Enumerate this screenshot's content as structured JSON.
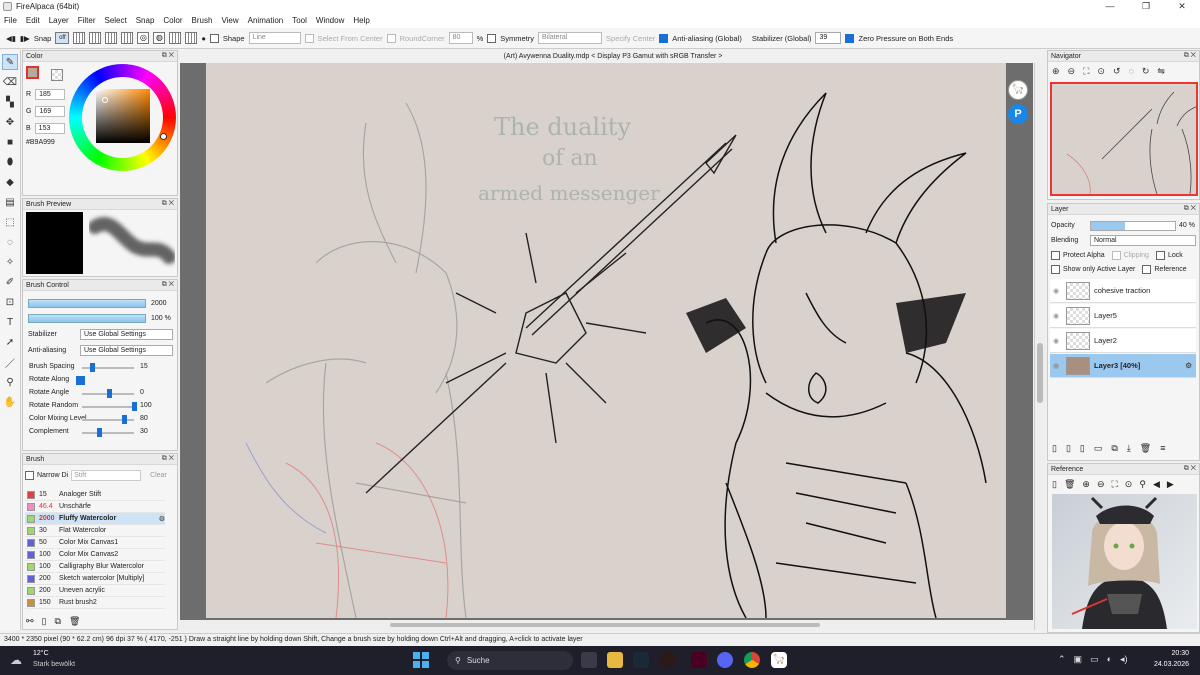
{
  "window": {
    "title": "FireAlpaca (64bit)"
  },
  "menu": [
    "File",
    "Edit",
    "Layer",
    "Filter",
    "Select",
    "Snap",
    "Color",
    "Brush",
    "View",
    "Animation",
    "Tool",
    "Window",
    "Help"
  ],
  "toolbar": {
    "snap_label": "Snap",
    "snap_off": "off",
    "shape_label": "Shape",
    "shape_value": "Line",
    "select_from_center": "Select From Center",
    "round_corner": "RoundCorner",
    "round_corner_value": "80",
    "percent": "%",
    "symmetry_label": "Symmetry",
    "symmetry_value": "Bilateral",
    "specify_center": "Specify Center",
    "anti_aliasing_global": "Anti-aliasing (Global)",
    "stabilizer_global": "Stabilizer (Global)",
    "stabilizer_value": "39",
    "zero_pressure": "Zero Pressure on Both Ends"
  },
  "color_panel": {
    "title": "Color",
    "r_label": "R",
    "r": "185",
    "g_label": "G",
    "g": "169",
    "b_label": "B",
    "b": "153",
    "hex": "#B9A999",
    "current_color": "#B9A999"
  },
  "brush_preview": {
    "title": "Brush Preview"
  },
  "brush_control": {
    "title": "Brush Control",
    "size": "2000",
    "opacity": "100 %",
    "stabilizer_label": "Stabilizer",
    "stabilizer_value": "Use Global Settings",
    "anti_aliasing_label": "Anti-aliasing",
    "anti_aliasing_value": "Use Global Settings",
    "sliders": [
      {
        "label": "Brush Spacing",
        "value": "15",
        "level": 0.15
      },
      {
        "label": "Rotate Along",
        "value": "",
        "level": 0
      },
      {
        "label": "Rotate Angle",
        "value": "0",
        "level": 0.5
      },
      {
        "label": "Rotate Random",
        "value": "100",
        "level": 1.0
      },
      {
        "label": "Color Mixing Level",
        "value": "80",
        "level": 0.8
      },
      {
        "label": "Complement",
        "value": "30",
        "level": 0.3
      }
    ]
  },
  "brush_panel": {
    "title": "Brush",
    "narrow_label": "Narrow Di",
    "filter_placeholder": "Stift",
    "clear_label": "Clear",
    "items": [
      {
        "size": "15",
        "name": "Analoger Stift",
        "color": "#e04040"
      },
      {
        "size": "46.4",
        "name": "Unschärfe",
        "color": "#f08cc8"
      },
      {
        "size": "2000",
        "name": "Fluffy Watercolor",
        "color": "#a0d870"
      },
      {
        "size": "30",
        "name": "Flat Watercolor",
        "color": "#a0d870"
      },
      {
        "size": "50",
        "name": "Color Mix Canvas1",
        "color": "#6060d8"
      },
      {
        "size": "100",
        "name": "Color Mix Canvas2",
        "color": "#6060d8"
      },
      {
        "size": "100",
        "name": "Calligraphy Blur Watercolor",
        "color": "#a0d870"
      },
      {
        "size": "200",
        "name": "Sketch watercolor [Multiply]",
        "color": "#6060d8"
      },
      {
        "size": "200",
        "name": "Uneven acrylic",
        "color": "#a0d870"
      },
      {
        "size": "150",
        "name": "Rust brush2",
        "color": "#c89040"
      }
    ]
  },
  "document": {
    "tab": "(Art) Avywenna Duality.mdp < Display P3 Gamut with sRGB Transfer >",
    "canvas_text_lines": [
      "The duality",
      "of an",
      "armed messenger"
    ]
  },
  "navigator": {
    "title": "Navigator"
  },
  "layer_panel": {
    "title": "Layer",
    "opacity_label": "Opacity",
    "opacity_value": "40 %",
    "opacity_level": 0.4,
    "blending_label": "Blending",
    "blending_value": "Normal",
    "protect_alpha": "Protect Alpha",
    "clipping": "Clipping",
    "lock": "Lock",
    "show_only_active": "Show only Active Layer",
    "reference": "Reference",
    "layers": [
      {
        "name": "cohesive traction",
        "selected": false
      },
      {
        "name": "Layer5",
        "selected": false
      },
      {
        "name": "Layer2",
        "selected": false
      },
      {
        "name": "Layer3 [40%]",
        "selected": true
      }
    ]
  },
  "reference_panel": {
    "title": "Reference"
  },
  "status": {
    "text": "3400 * 2350 pixel   (90 * 62.2 cm)   96 dpi   37 %   ( 4170, -251 )   Draw a straight line by holding down Shift, Change a brush size by holding down Ctrl+Alt and dragging, A+click to activate layer"
  },
  "taskbar": {
    "weather_temp": "12°C",
    "weather_desc": "Stark bewölkt",
    "search_placeholder": "Suche",
    "time": "20:30",
    "date": "24.03.2026"
  },
  "colors": {
    "accent": "#1a6fd6",
    "selection": "#9bc8ee",
    "canvas": "#d9d2cc",
    "taskbar": "#1f1f2b"
  }
}
